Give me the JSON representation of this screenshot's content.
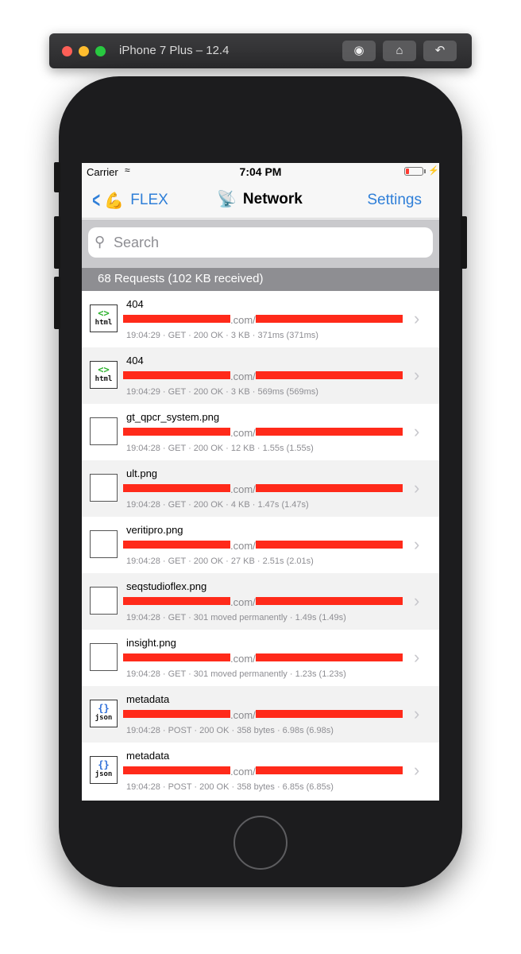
{
  "simulator": {
    "title": "iPhone 7 Plus – 12.4",
    "icons": [
      "screenshot-icon",
      "home-icon",
      "rotate-icon"
    ]
  },
  "status_bar": {
    "carrier": "Carrier",
    "time": "7:04 PM",
    "battery_level": 0.2
  },
  "nav": {
    "back_label": "FLEX",
    "title": "Network",
    "settings_label": "Settings"
  },
  "search": {
    "placeholder": "Search",
    "value": ""
  },
  "summary": "68 Requests (102 KB received)",
  "requests": [
    {
      "name": "404",
      "thumb_type": "html",
      "url_middle": ".com/",
      "meta": "19:04:29  ·  GET  ·  200 OK  ·  3 KB  ·  371ms (371ms)"
    },
    {
      "name": "404",
      "thumb_type": "html",
      "url_middle": ".com/",
      "meta": "19:04:29  ·  GET  ·  200 OK  ·  3 KB  ·  569ms (569ms)"
    },
    {
      "name": "gt_qpcr_system.png",
      "thumb_type": "image",
      "url_middle": ".com/",
      "meta": "19:04:28  ·  GET  ·  200 OK  ·  12 KB  ·  1.55s (1.55s)"
    },
    {
      "name": "ult.png",
      "thumb_type": "image",
      "url_middle": ".com/",
      "meta": "19:04:28  ·  GET  ·  200 OK  ·  4 KB  ·  1.47s (1.47s)"
    },
    {
      "name": "veritipro.png",
      "thumb_type": "image",
      "url_middle": ".com/",
      "meta": "19:04:28  ·  GET  ·  200 OK  ·  27 KB  ·  2.51s (2.01s)"
    },
    {
      "name": "seqstudioflex.png",
      "thumb_type": "image",
      "url_middle": ".com/",
      "meta": "19:04:28  ·  GET  ·  301 moved permanently  ·  1.49s (1.49s)"
    },
    {
      "name": "insight.png",
      "thumb_type": "image",
      "url_middle": ".com/",
      "meta": "19:04:28  ·  GET  ·  301 moved permanently  ·  1.23s (1.23s)"
    },
    {
      "name": "metadata",
      "thumb_type": "json",
      "url_middle": ".com/",
      "meta": "19:04:28  ·  POST  ·  200 OK  ·  358 bytes  ·  6.98s (6.98s)"
    },
    {
      "name": "metadata",
      "thumb_type": "json",
      "url_middle": ".com/",
      "meta": "19:04:28  ·  POST  ·  200 OK  ·  358 bytes  ·  6.85s (6.85s)"
    }
  ],
  "thumb_labels": {
    "html": {
      "sym": "<>",
      "label": "html"
    },
    "json": {
      "sym": "{}",
      "label": "json"
    }
  },
  "colors": {
    "accent": "#2f7fd8",
    "redaction": "#ff2a1a",
    "battery_low": "#ff3b30"
  }
}
